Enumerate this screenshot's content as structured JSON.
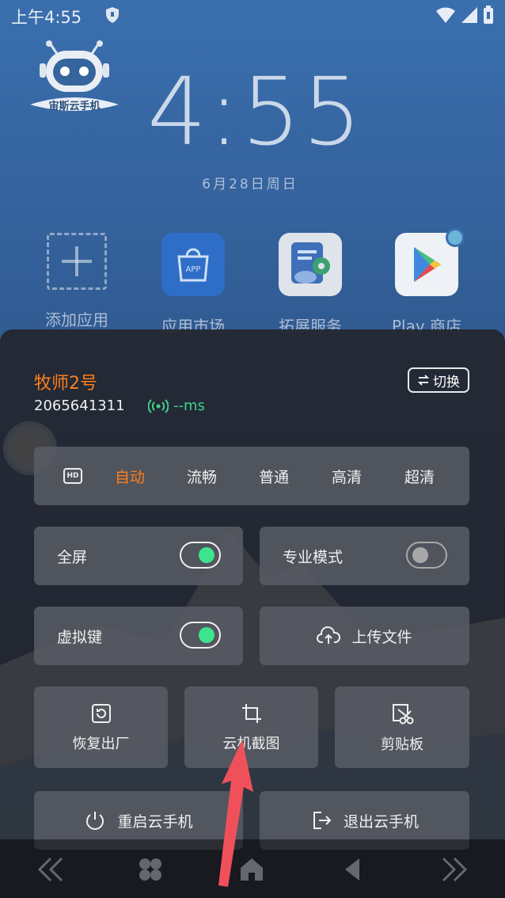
{
  "status_bar": {
    "time": "上午4:55"
  },
  "launcher": {
    "logo_text": "宙斯云手机",
    "clock": "4:55",
    "date": "6月28日周日",
    "apps": [
      {
        "label": "添加应用",
        "icon": "add-app-icon"
      },
      {
        "label": "应用市场",
        "icon": "app-market-icon",
        "badge_text": "APP"
      },
      {
        "label": "拓展服务",
        "icon": "extend-service-icon"
      },
      {
        "label": "Play 商店",
        "icon": "play-store-icon"
      }
    ]
  },
  "panel": {
    "device_name": "牧师2号",
    "device_id": "2065641311",
    "latency": "--ms",
    "switch_label": "切换",
    "quality": {
      "badge": "HD",
      "options": [
        "自动",
        "流畅",
        "普通",
        "高清",
        "超清"
      ],
      "selected": "自动"
    },
    "toggles": {
      "fullscreen": {
        "label": "全屏",
        "on": true
      },
      "pro_mode": {
        "label": "专业模式",
        "on": false
      },
      "virtual_keys": {
        "label": "虚拟键",
        "on": true
      }
    },
    "upload_label": "上传文件",
    "tiles": {
      "factory_reset": "恢复出厂",
      "screenshot": "云机截图",
      "clipboard": "剪贴板"
    },
    "restart_label": "重启云手机",
    "exit_label": "退出云手机"
  },
  "colors": {
    "accent_orange": "#ff7e1a",
    "toggle_green": "#3ee58c",
    "ping_green": "#3fd38a",
    "arrow_red": "#f0505a"
  }
}
